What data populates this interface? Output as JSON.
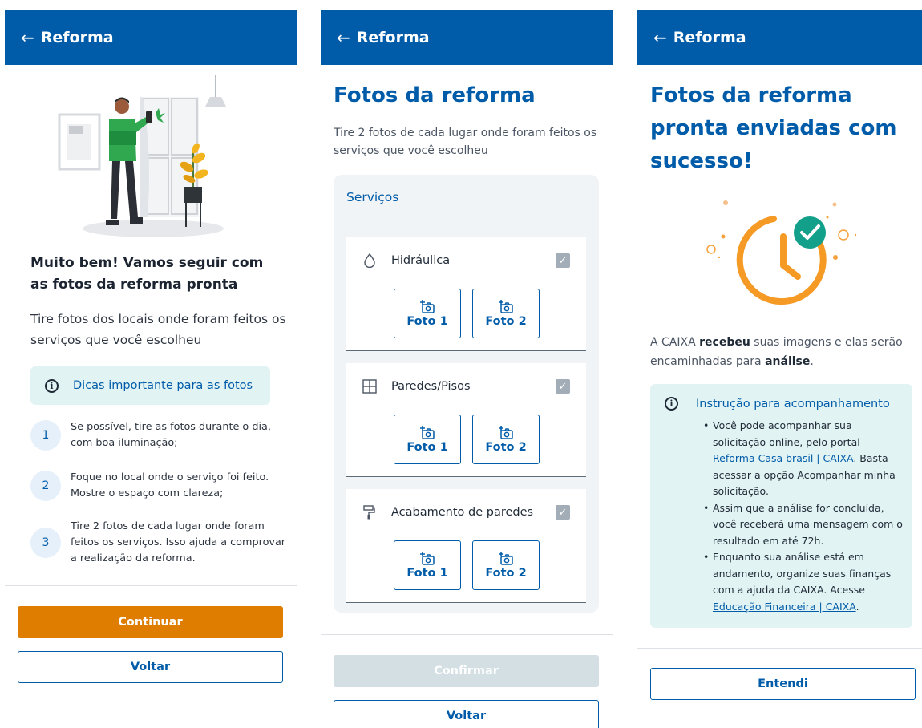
{
  "header": {
    "back_icon": "arrow-left-icon",
    "title": "Reforma"
  },
  "colors": {
    "primary": "#005ca9",
    "accent": "#de7d00",
    "info_bg": "#e2f3f4",
    "success": "#12a08a"
  },
  "screen1": {
    "heading": "Muito bem! Vamos seguir com as fotos da reforma pronta",
    "subtitle": "Tire fotos dos locais onde foram feitos os serviços que você escolheu",
    "tips_label": "Dicas importante para as fotos",
    "steps": [
      {
        "num": "1",
        "text": "Se possível, tire as fotos durante o dia, com boa iluminação;"
      },
      {
        "num": "2",
        "text": "Foque no local onde o serviço foi feito. Mostre o espaço com clareza;"
      },
      {
        "num": "3",
        "text": "Tire 2 fotos de cada lugar onde foram feitos os serviços. Isso ajuda a comprovar a realização da reforma."
      }
    ],
    "continue_label": "Continuar",
    "back_label": "Voltar"
  },
  "screen2": {
    "title": "Fotos da reforma",
    "subtitle": "Tire 2 fotos de cada lugar onde foram feitos os serviços que você escolheu",
    "services_label": "Serviços",
    "services": [
      {
        "name": "Hidráulica",
        "icon": "water-drop-icon",
        "checked": true,
        "photo1": "Foto 1",
        "photo2": "Foto 2"
      },
      {
        "name": "Paredes/Pisos",
        "icon": "grid-icon",
        "checked": true,
        "photo1": "Foto 1",
        "photo2": "Foto 2"
      },
      {
        "name": "Acabamento de paredes",
        "icon": "paint-roller-icon",
        "checked": true,
        "photo1": "Foto 1",
        "photo2": "Foto 2"
      }
    ],
    "confirm_label": "Confirmar",
    "back_label": "Voltar"
  },
  "screen3": {
    "title": "Fotos da reforma pronta enviadas com sucesso!",
    "msg_part1": "A CAIXA ",
    "msg_bold1": "recebeu",
    "msg_part2": " suas imagens e elas serão encaminhadas para ",
    "msg_bold2": "análise",
    "msg_part3": ".",
    "instruction_title": "Instrução para acompanhamento",
    "item1_text1": "Você pode acompanhar sua solicitação online, pelo portal ",
    "item1_link": "Reforma Casa brasil | CAIXA",
    "item1_text2": ". Basta acessar a opção Acompanhar minha solicitação.",
    "item2_text": "Assim que a análise for concluída, você receberá uma mensagem com o resultado em até 72h.",
    "item3_text1": "Enquanto sua análise está em andamento, organize suas finanças com a ajuda da CAIXA. Acesse ",
    "item3_link": "Educação Financeira | CAIXA",
    "item3_text2": ".",
    "understood_label": "Entendi"
  }
}
